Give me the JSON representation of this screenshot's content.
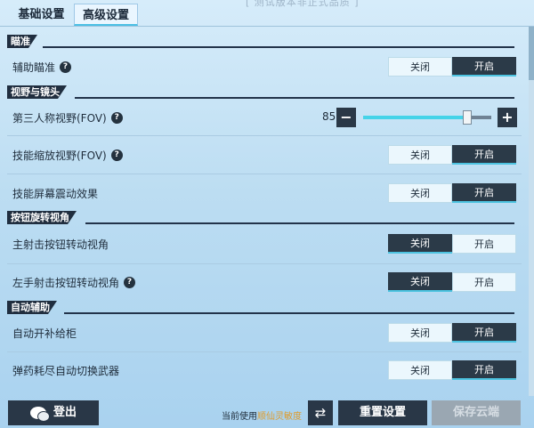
{
  "tabs": [
    "基础设置",
    "高级设置"
  ],
  "watermark": "[ 测试版本非正式品质 ]",
  "sections": {
    "aim": "瞄准",
    "view": "视野与镜头",
    "button_rotate": "按钮旋转视角",
    "auto_assist": "自动辅助"
  },
  "rows": {
    "aim_assist": {
      "label": "辅助瞄准",
      "off": "关闭",
      "on": "开启",
      "selected": "on"
    },
    "fov": {
      "label": "第三人称视野(FOV)",
      "value": "85",
      "minus": "−",
      "plus": "+",
      "fill_fraction": 0.81
    },
    "skill_zoom_fov": {
      "label": "技能缩放视野(FOV)",
      "off": "关闭",
      "on": "开启",
      "selected": "on"
    },
    "skill_shake": {
      "label": "技能屏幕震动效果",
      "off": "关闭",
      "on": "开启",
      "selected": "on"
    },
    "main_fire_rotate": {
      "label": "主射击按钮转动视角",
      "off": "关闭",
      "on": "开启",
      "selected": "off"
    },
    "left_fire_rotate": {
      "label": "左手射击按钮转动视角",
      "off": "关闭",
      "on": "开启",
      "selected": "off"
    },
    "auto_supply": {
      "label": "自动开补给柜",
      "off": "关闭",
      "on": "开启",
      "selected": "on"
    },
    "auto_switch": {
      "label": "弹药耗尽自动切换武器",
      "off": "关闭",
      "on": "开启",
      "selected": "on"
    }
  },
  "help_glyph": "?",
  "footer": {
    "login": "登出",
    "sens_prefix": "当前使用",
    "sens_name": "顺仙灵敏度",
    "swap_glyph": "⇄",
    "reset": "重置设置",
    "save_cloud": "保存云端"
  }
}
